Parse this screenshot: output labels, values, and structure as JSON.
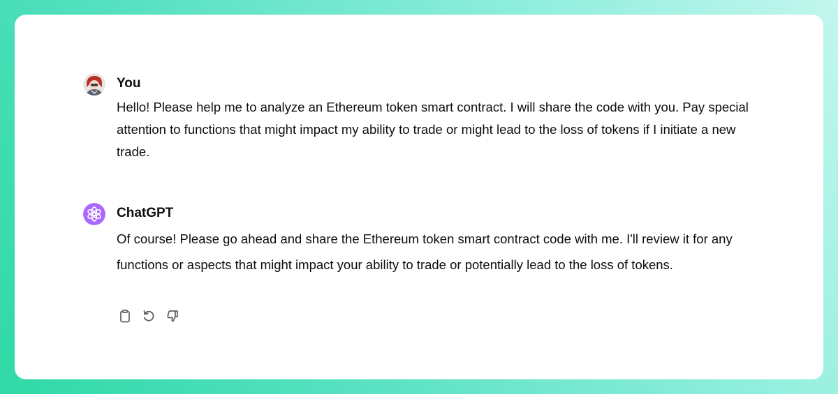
{
  "conversation": {
    "messages": [
      {
        "author": "You",
        "text": "Hello! Please help me to analyze an Ethereum token smart contract. I will share the code with you. Pay special attention to functions that might impact my ability to trade or might lead to the loss of tokens if I initiate a new trade."
      },
      {
        "author": "ChatGPT",
        "text": "Of course! Please go ahead and share the Ethereum token smart contract code with me. I'll review it for any functions or aspects that might impact your ability to trade or potentially lead to the loss of tokens."
      }
    ]
  },
  "actions": {
    "icons": [
      "clipboard-icon",
      "regenerate-icon",
      "thumbs-down-icon"
    ]
  },
  "colors": {
    "bot_avatar": "#ab68ff",
    "text": "#0d0d0d",
    "icon": "#5d5d5d"
  }
}
